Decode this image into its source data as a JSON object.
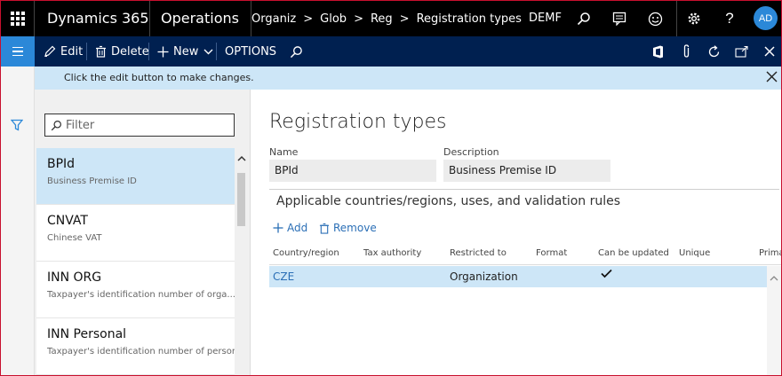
{
  "topbar": {
    "brand": "Dynamics 365",
    "module": "Operations",
    "breadcrumbs": [
      "Organiz",
      "Glob",
      "Reg",
      "Registration types"
    ],
    "company": "DEMF",
    "avatar_initials": "AD"
  },
  "actions": {
    "edit": "Edit",
    "delete": "Delete",
    "new": "New",
    "options": "OPTIONS"
  },
  "info": {
    "message": "Click the edit button to make changes."
  },
  "list": {
    "filter_placeholder": "Filter",
    "items": [
      {
        "title": "BPId",
        "subtitle": "Business Premise ID"
      },
      {
        "title": "CNVAT",
        "subtitle": "Chinese VAT"
      },
      {
        "title": "INN ORG",
        "subtitle": "Taxpayer's identification number of orga..."
      },
      {
        "title": "INN Personal",
        "subtitle": "Taxpayer's identification number of person."
      }
    ]
  },
  "detail": {
    "page_title": "Registration types",
    "name_label": "Name",
    "name_value": "BPId",
    "description_label": "Description",
    "description_value": "Business Premise ID",
    "section_title": "Applicable countries/regions, uses, and validation rules",
    "add_label": "Add",
    "remove_label": "Remove",
    "columns": [
      "Country/region",
      "Tax authority",
      "Restricted to",
      "Format",
      "Can be updated",
      "Unique",
      "Prima"
    ],
    "rows": [
      {
        "country": "CZE",
        "tax_authority": "",
        "restricted_to": "Organization",
        "format": "",
        "can_be_updated": true,
        "unique": ""
      }
    ]
  },
  "colors": {
    "topbar": "#000000",
    "actionbar": "#002050",
    "accent": "#2b88d8",
    "selection": "#cde6f7",
    "link": "#2b6fb6"
  },
  "icons": [
    "waffle-icon",
    "search-icon",
    "chat-icon",
    "smiley-icon",
    "gear-icon",
    "help-icon",
    "hamburger-icon",
    "pencil-icon",
    "trash-icon",
    "plus-icon",
    "chevron-down-icon",
    "office-icon",
    "paperclip-icon",
    "refresh-icon",
    "popout-icon",
    "close-icon",
    "funnel-icon",
    "chevron-up-icon",
    "checkmark-icon"
  ]
}
